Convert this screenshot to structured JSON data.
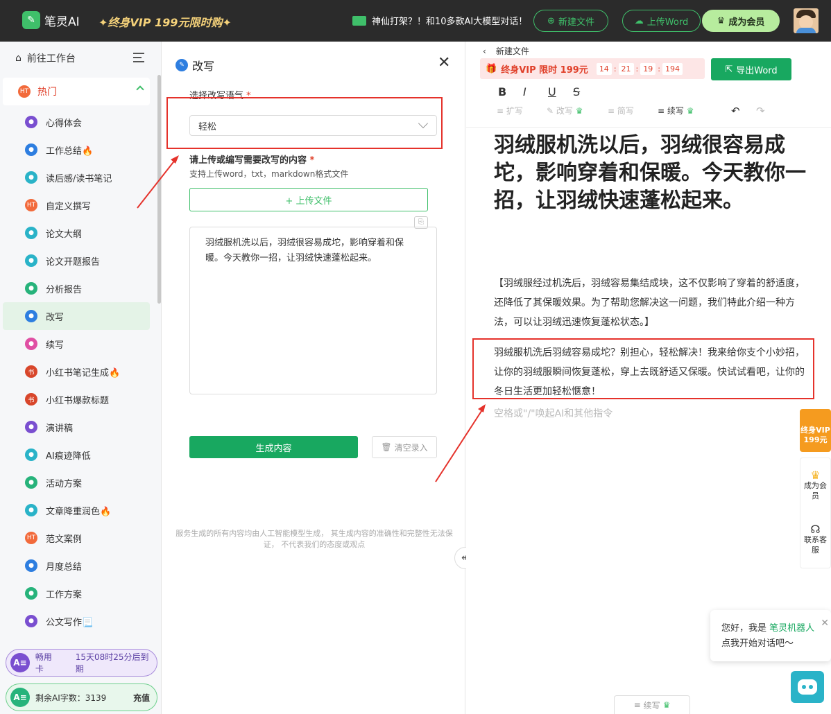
{
  "app": {
    "name": "笔灵AI",
    "promo": "✦终身VIP 199元限时购✦"
  },
  "header": {
    "notice": "神仙打架？！和10多款AI大模型对话！",
    "new_file": "新建文件",
    "upload_word": "上传Word",
    "become_member": "成为会员"
  },
  "sidebar": {
    "workspace": "前往工作台",
    "hot_label": "热门",
    "items": [
      {
        "label": "心得体会",
        "icon": "star-icon",
        "color": "purple"
      },
      {
        "label": "工作总结🔥",
        "icon": "briefcase-icon",
        "color": "blue"
      },
      {
        "label": "读后感/读书笔记",
        "icon": "book-icon",
        "color": "teal"
      },
      {
        "label": "自定义撰写",
        "icon": "fire-icon",
        "color": "fire"
      },
      {
        "label": "论文大纲",
        "icon": "doc-icon",
        "color": "teal"
      },
      {
        "label": "论文开题报告",
        "icon": "doc-icon",
        "color": "teal"
      },
      {
        "label": "分析报告",
        "icon": "file-icon",
        "color": "green"
      },
      {
        "label": "改写",
        "icon": "rewrite-icon",
        "color": "blue"
      },
      {
        "label": "续写",
        "icon": "continue-icon",
        "color": "pink"
      },
      {
        "label": "小红书笔记生成🔥",
        "icon": "xhs-icon",
        "color": "red"
      },
      {
        "label": "小红书爆款标题",
        "icon": "xhs-icon",
        "color": "red"
      },
      {
        "label": "演讲稿",
        "icon": "star-icon",
        "color": "purple"
      },
      {
        "label": "AI痕迹降低",
        "icon": "doc-icon",
        "color": "teal"
      },
      {
        "label": "活动方案",
        "icon": "file-icon",
        "color": "green"
      },
      {
        "label": "文章降重润色🔥",
        "icon": "doc-icon",
        "color": "teal"
      },
      {
        "label": "范文案例",
        "icon": "fire-icon",
        "color": "fire"
      },
      {
        "label": "月度总结",
        "icon": "briefcase-icon",
        "color": "blue"
      },
      {
        "label": "工作方案",
        "icon": "file-icon",
        "color": "green"
      },
      {
        "label": "公文写作📃",
        "icon": "star-icon",
        "color": "purple"
      }
    ],
    "card_vip": {
      "label": "畅用卡",
      "expire": "15天08时25分后到期"
    },
    "card_words": {
      "label": "剩余AI字数：3139",
      "action": "充值"
    }
  },
  "panel": {
    "title": "改写",
    "tone_label": "选择改写语气",
    "tone_value": "轻松",
    "content_label": "请上传或编写需要改写的内容",
    "support": "支持上传word，txt，markdown格式文件",
    "upload_btn": "+ 上传文件",
    "input_text": "羽绒服机洗以后，羽绒很容易成坨，影响穿着和保暖。今天教你一招，让羽绒快速蓬松起来。",
    "generate": "生成内容",
    "clear": "清空录入",
    "disclaimer": "服务生成的所有内容均由人工智能模型生成， 其生成内容的准确性和完整性无法保证， 不代表我们的态度或观点"
  },
  "editor": {
    "breadcrumb": "新建文件",
    "vip_text": "终身VIP 限时 199元",
    "timer": [
      "14",
      "21",
      "19",
      "194"
    ],
    "export": "导出Word",
    "tools": {
      "expand": "扩写",
      "rewrite": "改写",
      "simplify": "简写",
      "continue": "续写"
    },
    "heading": "羽绒服机洗以后，羽绒很容易成坨，影响穿着和保暖。今天教你一招，让羽绒快速蓬松起来。",
    "para1": "【羽绒服经过机洗后，羽绒容易集结成块，这不仅影响了穿着的舒适度，还降低了其保暖效果。为了帮助您解决这一问题，我们特此介绍一种方法，可以让羽绒迅速恢复蓬松状态。】",
    "para2": "羽绒服机洗后羽绒容易成坨？别担心，轻松解决！我来给你支个小妙招，让你的羽绒服瞬间恢复蓬松，穿上去既舒适又保暖。快试试看吧，让你的冬日生活更加轻松惬意！",
    "hint": "空格或\"/\"唤起AI和其他指令",
    "continue_bottom": "续写"
  },
  "float": {
    "vip_badge": "终身VIP 199元",
    "member": "成为会员",
    "service": "联系客服"
  },
  "chat": {
    "greeting": "您好，我是",
    "bot_name": "笔灵机器人",
    "line2": "点我开始对话吧～"
  }
}
